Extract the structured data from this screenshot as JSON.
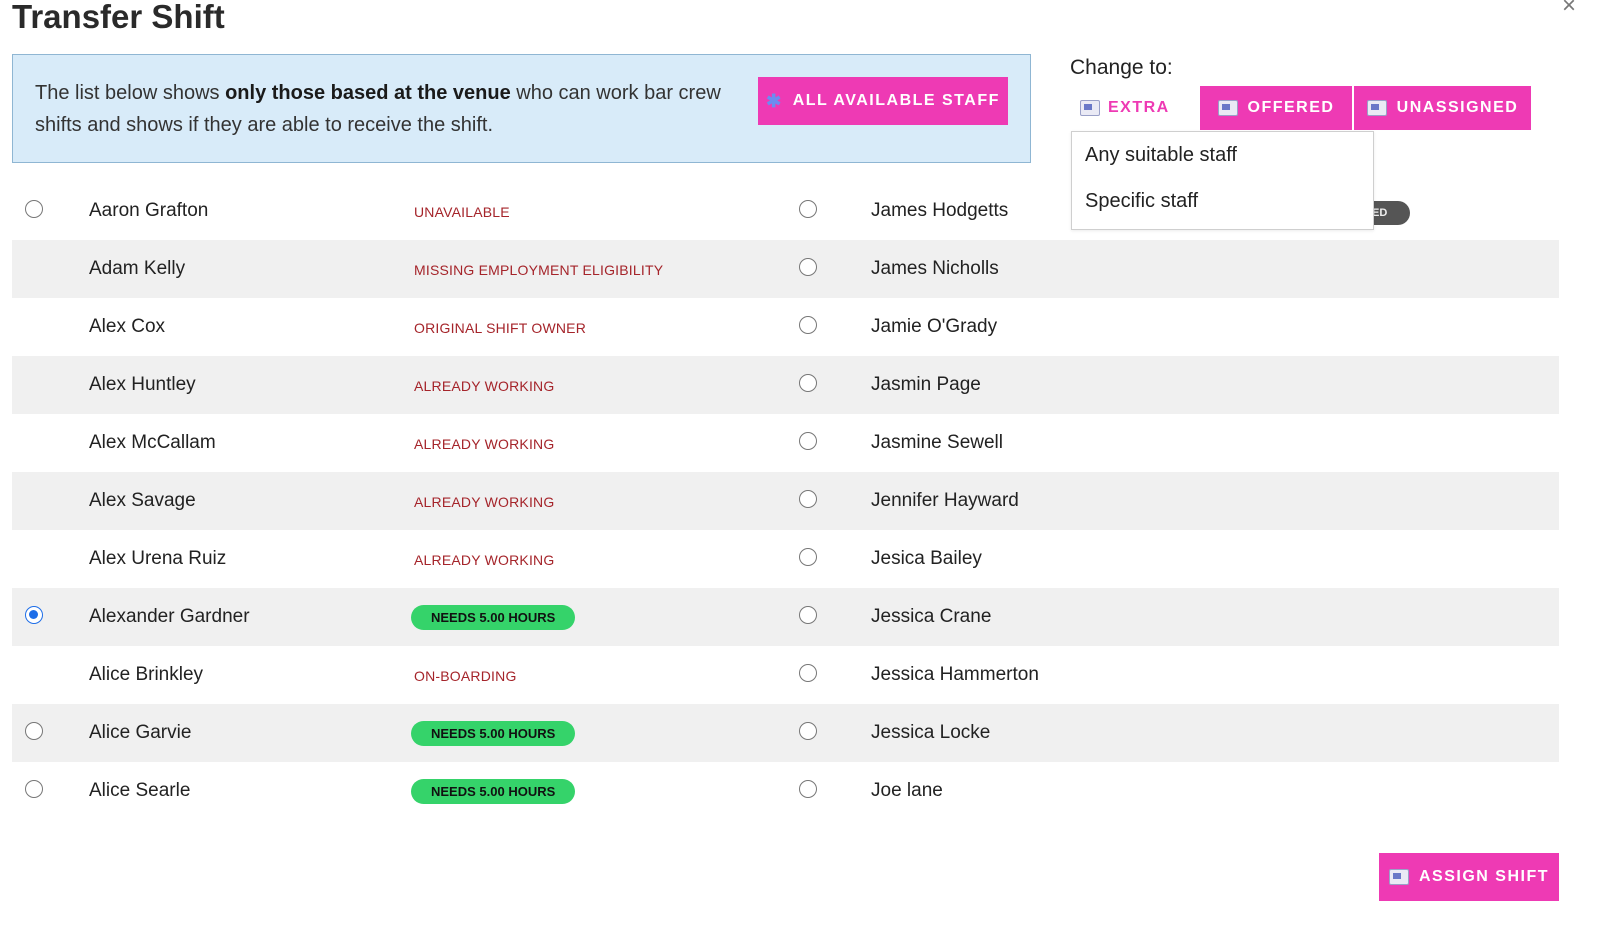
{
  "dialog": {
    "title": "Transfer Shift",
    "close_glyph": "×"
  },
  "info": {
    "text_before": "The list below shows ",
    "text_bold": "only those based at the venue",
    "text_after": " who can work bar crew shifts and shows if they are able to receive the shift.",
    "all_staff_button": "ALL AVAILABLE STAFF",
    "all_staff_icon": "star-person-icon"
  },
  "change_to": {
    "label": "Change to:",
    "options": [
      {
        "label": "EXTRA",
        "icon": "shift-card-icon",
        "active": false
      },
      {
        "label": "OFFERED",
        "icon": "shift-card-icon",
        "active": true
      },
      {
        "label": "UNASSIGNED",
        "icon": "shift-card-icon",
        "active": true
      }
    ],
    "dropdown": [
      "Any suitable staff",
      "Specific staff"
    ],
    "partial_badge": "ED"
  },
  "colors": {
    "accent_pink": "#ee3ab4",
    "info_bg": "#d8ebf9",
    "status_red": "#a5242a",
    "badge_green": "#35d36a",
    "radio_blue": "#1e6ee8"
  },
  "staff_rows": [
    {
      "left_name": "Aaron Grafton",
      "left_radio": "unchecked",
      "status": "UNAVAILABLE",
      "status_type": "text",
      "right_name": "James Hodgetts"
    },
    {
      "left_name": "Adam Kelly",
      "left_radio": "none",
      "status": "MISSING EMPLOYMENT ELIGIBILITY",
      "status_type": "text",
      "right_name": "James Nicholls"
    },
    {
      "left_name": "Alex Cox",
      "left_radio": "none",
      "status": "ORIGINAL SHIFT OWNER",
      "status_type": "text",
      "right_name": "Jamie O'Grady"
    },
    {
      "left_name": "Alex Huntley",
      "left_radio": "none",
      "status": "ALREADY WORKING",
      "status_type": "text",
      "right_name": "Jasmin Page"
    },
    {
      "left_name": "Alex McCallam",
      "left_radio": "none",
      "status": "ALREADY WORKING",
      "status_type": "text",
      "right_name": "Jasmine Sewell"
    },
    {
      "left_name": "Alex Savage",
      "left_radio": "none",
      "status": "ALREADY WORKING",
      "status_type": "text",
      "right_name": "Jennifer Hayward"
    },
    {
      "left_name": "Alex Urena Ruiz",
      "left_radio": "none",
      "status": "ALREADY WORKING",
      "status_type": "text",
      "right_name": "Jesica Bailey"
    },
    {
      "left_name": "Alexander Gardner",
      "left_radio": "checked",
      "status": "NEEDS 5.00 HOURS",
      "status_type": "badge",
      "right_name": "Jessica Crane"
    },
    {
      "left_name": "Alice Brinkley",
      "left_radio": "none",
      "status": "ON-BOARDING",
      "status_type": "text",
      "right_name": "Jessica Hammerton"
    },
    {
      "left_name": "Alice Garvie",
      "left_radio": "unchecked",
      "status": "NEEDS 5.00 HOURS",
      "status_type": "badge",
      "right_name": "Jessica Locke"
    },
    {
      "left_name": "Alice Searle",
      "left_radio": "unchecked",
      "status": "NEEDS 5.00 HOURS",
      "status_type": "badge",
      "right_name": "Joe lane"
    }
  ],
  "footer": {
    "assign_button": "ASSIGN SHIFT",
    "assign_icon": "shift-card-icon"
  }
}
